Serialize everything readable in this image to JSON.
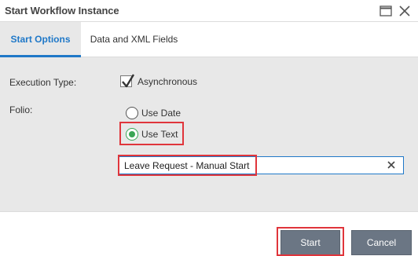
{
  "window": {
    "title": "Start Workflow Instance",
    "maximize_icon": "maximize-icon",
    "close_icon": "close-icon"
  },
  "tabs": [
    {
      "label": "Start Options",
      "active": true
    },
    {
      "label": "Data and XML Fields",
      "active": false
    }
  ],
  "form": {
    "execution_type_label": "Execution Type:",
    "asynchronous_label": "Asynchronous",
    "asynchronous_checked": true,
    "folio_label": "Folio:",
    "folio_options": [
      {
        "label": "Use Date",
        "selected": false
      },
      {
        "label": "Use Text",
        "selected": true
      }
    ],
    "folio_text_value": "Leave Request - Manual Start"
  },
  "footer": {
    "start_label": "Start",
    "cancel_label": "Cancel"
  },
  "colors": {
    "accent": "#1f78c8",
    "highlight": "#e0353b",
    "radio_selected": "#3aa655",
    "button": "#6b7684",
    "panel": "#e8e8e8"
  }
}
